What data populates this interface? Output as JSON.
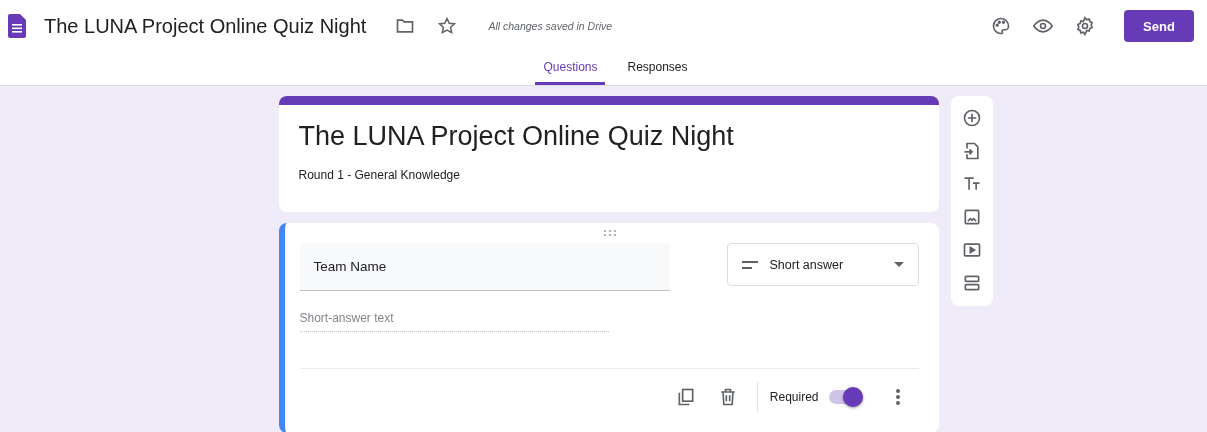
{
  "header": {
    "title": "The LUNA Project Online Quiz Night",
    "save_status": "All changes saved in Drive",
    "send_button": "Send"
  },
  "tabs": [
    {
      "label": "Questions",
      "selected": true
    },
    {
      "label": "Responses",
      "selected": false
    }
  ],
  "form": {
    "title": "The LUNA Project Online Quiz Night",
    "description": "Round 1 - General Knowledge"
  },
  "question": {
    "title": "Team Name",
    "type": "Short answer",
    "answer_placeholder": "Short-answer text",
    "required_label": "Required",
    "required": true
  }
}
